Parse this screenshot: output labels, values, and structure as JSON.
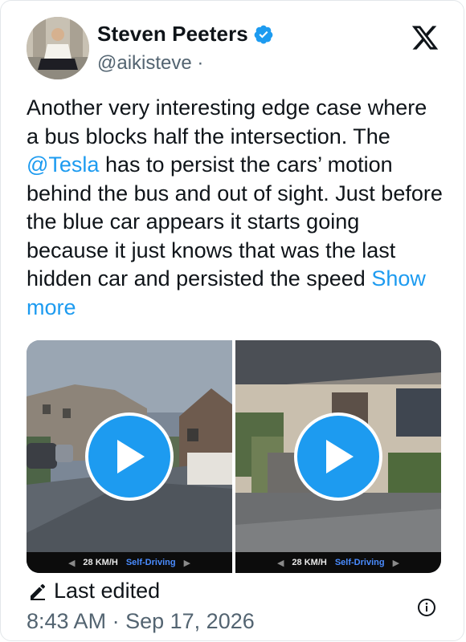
{
  "author": {
    "name": "Steven Peeters",
    "handle": "@aikisteve",
    "handle_sep": "·"
  },
  "tweet": {
    "text_before": "Another very interesting edge case where a bus blocks half the intersection. The ",
    "mention": "@Tesla",
    "text_after": " has to persist the cars’ motion behind the bus and out of sight. Just before the blue car appears it starts going because it just knows that was the last hidden car and persisted the speed ",
    "show_more": "Show more"
  },
  "media": [
    {
      "speed": "28 KM/H",
      "mode": "Self-Driving"
    },
    {
      "speed": "28 KM/H",
      "mode": "Self-Driving"
    }
  ],
  "footer": {
    "edited_label": "Last edited",
    "time": "8:43 AM",
    "sep": "·",
    "date": "Sep 17, 2026"
  },
  "colors": {
    "accent": "#1d9bf0",
    "text": "#0f1419",
    "muted": "#536471"
  },
  "icons": [
    "verified-badge-icon",
    "x-logo-icon",
    "play-icon",
    "pencil-icon",
    "info-icon"
  ]
}
